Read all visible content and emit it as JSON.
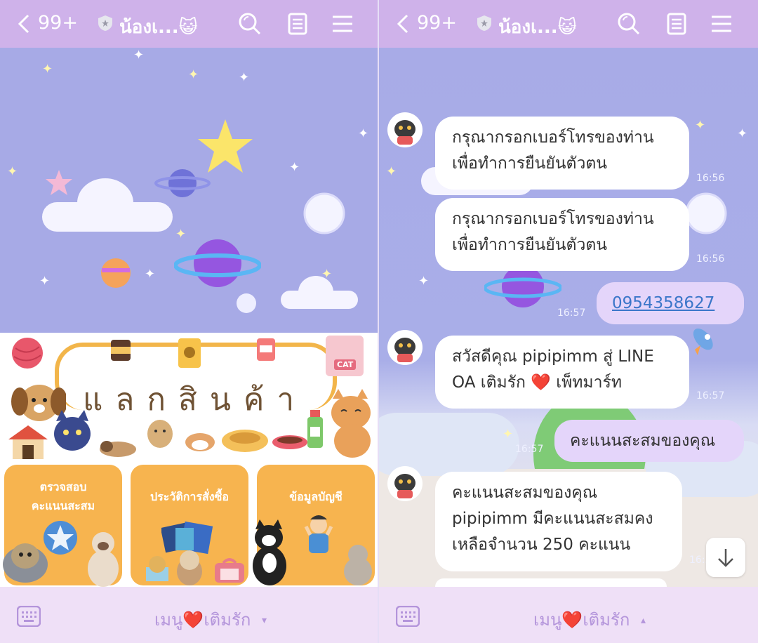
{
  "header": {
    "back_count": "99+",
    "title": "น้องเ...",
    "title_emoji": "😺"
  },
  "rich_menu": {
    "title": "แลกสินค้า",
    "buttons": [
      {
        "label_line1": "ตรวจสอบ",
        "label_line2": "คะแนนสะสม"
      },
      {
        "label_line1": "ประวัติการสั่งซื้อ",
        "label_line2": ""
      },
      {
        "label_line1": "ข้อมูลบัญชี",
        "label_line2": ""
      }
    ],
    "cat_tag": "CAT"
  },
  "bottom_bar": {
    "left_label": "เมนู❤️เติมรัก",
    "left_caret": "▾",
    "right_label": "เมนู❤️เติมรัก",
    "right_caret": "▴"
  },
  "chat": {
    "messages": [
      {
        "from": "bot",
        "line1": "กรุณากรอกเบอร์โทรของท่าน",
        "line2": "เพื่อทำการยืนยันตัวตน",
        "time": "16:56"
      },
      {
        "from": "bot",
        "line1": "กรุณากรอกเบอร์โทรของท่าน",
        "line2": "เพื่อทำการยืนยันตัวตน",
        "time": "16:56"
      },
      {
        "from": "me",
        "line1": "0954358627",
        "time": "16:57"
      },
      {
        "from": "bot",
        "line1": "สวัสดีคุณ pipipimm สู่ LINE",
        "line2": "OA เติมรัก ❤️ เพ็ทมาร์ท",
        "time": "16:57"
      },
      {
        "from": "me",
        "line1": "คะแนนสะสมของคุณ",
        "time": "16:57"
      },
      {
        "from": "bot",
        "line1": "คะแนนสะสมของคุณ",
        "line2": "pipipimm มีคะแนนสะสมคง",
        "line3": "เหลือจำนวน 250 คะแนน",
        "time": "16:57"
      }
    ]
  },
  "icons": {
    "back": "chevron-left-icon",
    "shield": "shield-icon",
    "search": "search-icon",
    "notes": "notes-icon",
    "menu": "hamburger-icon",
    "keyboard": "keyboard-icon",
    "scroll_down": "arrow-down-icon"
  },
  "colors": {
    "header": "#cfb2ea",
    "sky": "#a7aae6",
    "bottom_bar": "#efe0f7",
    "menu_label": "#b495db",
    "rich_menu_button": "#f7b44f"
  }
}
